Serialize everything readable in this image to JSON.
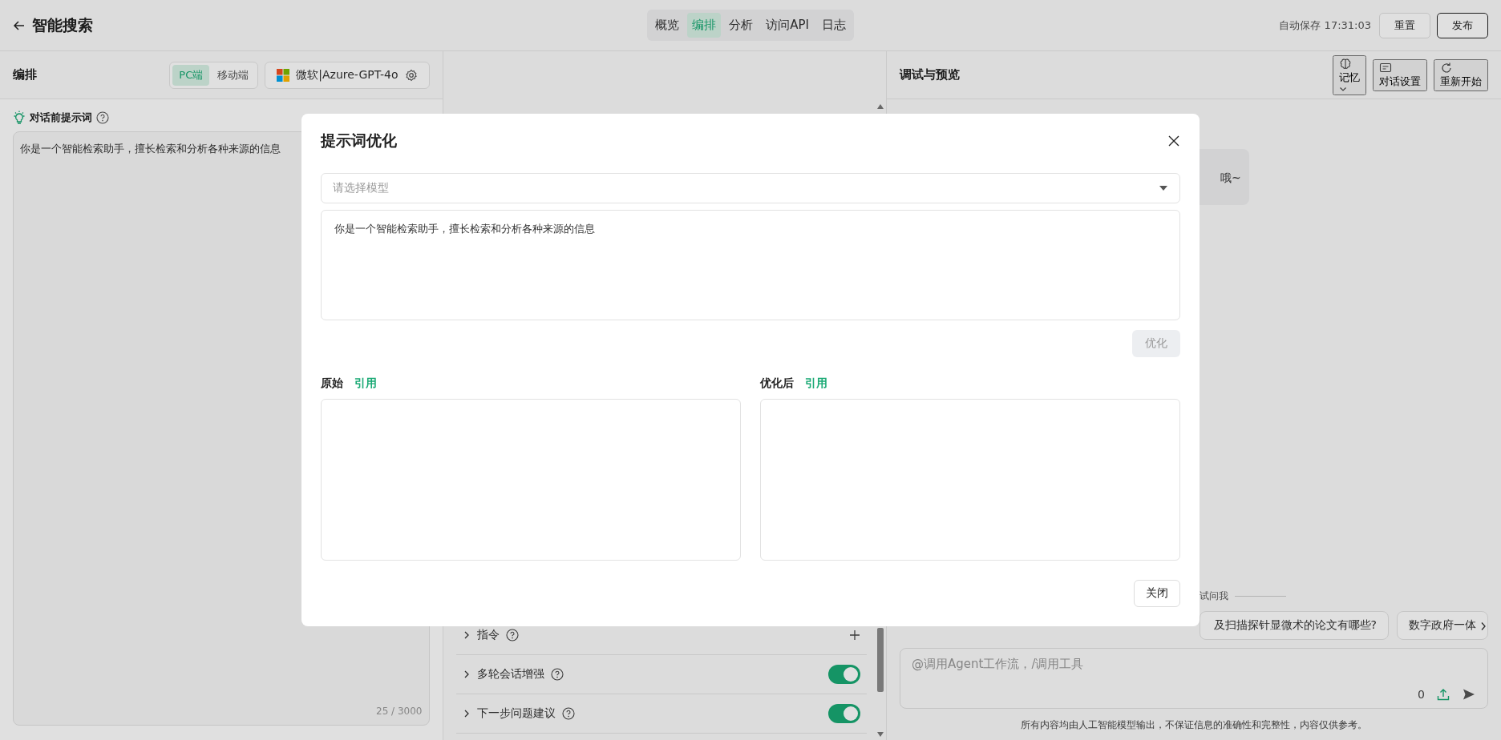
{
  "header": {
    "title": "智能搜索",
    "tabs": [
      {
        "label": "概览",
        "selected": false
      },
      {
        "label": "编排",
        "selected": true
      },
      {
        "label": "分析",
        "selected": false
      },
      {
        "label": "访问API",
        "selected": false
      },
      {
        "label": "日志",
        "selected": false
      }
    ],
    "autosave": "自动保存 17:31:03",
    "buttons": [
      {
        "label": "重置",
        "kind": "default"
      },
      {
        "label": "发布",
        "kind": "primary"
      }
    ]
  },
  "left_panel": {
    "title": "编排",
    "platforms": [
      {
        "label": "PC端",
        "selected": true
      },
      {
        "label": "移动端",
        "selected": false
      }
    ],
    "model": "微软|Azure-GPT-4o",
    "prompt": {
      "title": "对话前提示词",
      "value": "你是一个智能检索助手，擅长检索和分析各种来源的信息",
      "counter": "25 / 3000"
    }
  },
  "middle_panel": {
    "rows": [
      {
        "label": "指令",
        "kind": "add"
      },
      {
        "label": "多轮会话增强",
        "kind": "toggle",
        "on": true
      },
      {
        "label": "下一步问题建议",
        "kind": "toggle",
        "on": true
      }
    ]
  },
  "right_panel": {
    "title": "调试与预览",
    "buttons": [
      {
        "label": "记忆",
        "kind": "memory"
      },
      {
        "label": "对话设置",
        "kind": "settings"
      },
      {
        "label": "重新开始",
        "kind": "restart"
      }
    ],
    "bubble": "哦~",
    "suggestions_label": "试问我",
    "suggestions": [
      "及扫描探针显微术的论文有哪些?",
      "数字政府一体"
    ],
    "input": {
      "placeholder": "@调用Agent工作流，/调用工具",
      "count": "0"
    },
    "disclaimer": "所有内容均由人工智能模型输出，不保证信息的准确性和完整性，内容仅供参考。"
  },
  "dialog": {
    "title": "提示词优化",
    "model_select": {
      "placeholder": "请选择模型"
    },
    "prompt": "你是一个智能检索助手，擅长检索和分析各种来源的信息",
    "optimize_button": {
      "label": "优化",
      "disabled": true
    },
    "columns": [
      {
        "label": "原始",
        "action": "引用"
      },
      {
        "label": "优化后",
        "action": "引用"
      }
    ],
    "close_button": "关闭"
  }
}
